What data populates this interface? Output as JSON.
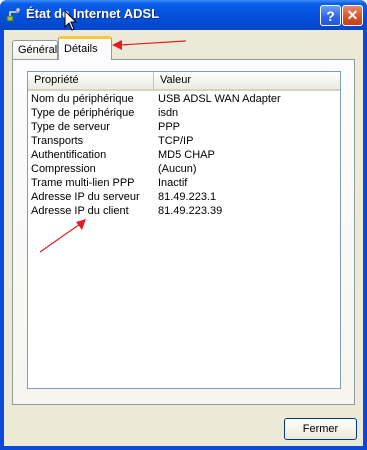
{
  "window": {
    "title": "État de Internet ADSL",
    "help_label": "?",
    "close_label": "✕"
  },
  "tabs": [
    {
      "label": "Général",
      "selected": false
    },
    {
      "label": "Détails",
      "selected": true
    }
  ],
  "table": {
    "columns": [
      "Propriété",
      "Valeur"
    ],
    "rows": [
      {
        "property": "Nom du périphérique",
        "value": "USB ADSL WAN Adapter"
      },
      {
        "property": "Type de périphérique",
        "value": "isdn"
      },
      {
        "property": "Type de serveur",
        "value": "PPP"
      },
      {
        "property": "Transports",
        "value": "TCP/IP"
      },
      {
        "property": "Authentification",
        "value": "MD5 CHAP"
      },
      {
        "property": "Compression",
        "value": "(Aucun)"
      },
      {
        "property": "Trame multi-lien PPP",
        "value": "Inactif"
      },
      {
        "property": "Adresse IP du serveur",
        "value": "81.49.223.1"
      },
      {
        "property": "Adresse IP du client",
        "value": "81.49.223.39"
      }
    ]
  },
  "footer": {
    "close_button": "Fermer"
  },
  "colors": {
    "titlebar": "#0553e0",
    "annotation_arrow": "#e02020",
    "selected_tab_accent": "#ffc73c"
  }
}
